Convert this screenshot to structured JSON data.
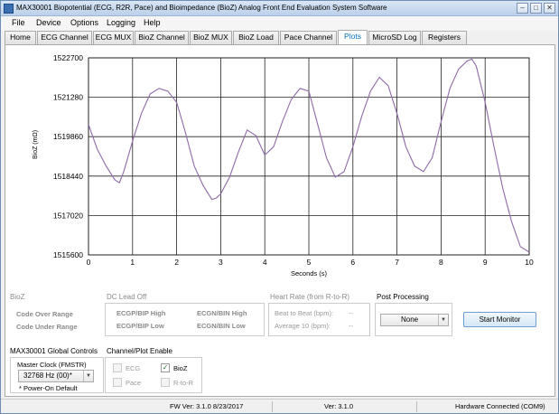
{
  "window": {
    "title": "MAX30001 Biopotential (ECG, R2R, Pace) and Bioimpedance (BioZ) Analog Front End Evaluation System Software",
    "controls": [
      "–",
      "□",
      "✕"
    ]
  },
  "menu": [
    "File",
    "Device",
    "Options",
    "Logging",
    "Help"
  ],
  "tabs": [
    "Home",
    "ECG Channel",
    "ECG MUX",
    "BioZ Channel",
    "BioZ MUX",
    "BioZ Load",
    "Pace Channel",
    "Plots",
    "MicroSD Log",
    "Registers"
  ],
  "active_tab": "Plots",
  "chart_data": {
    "type": "line",
    "title": "",
    "xlabel": "Seconds (s)",
    "ylabel": "BioZ (mΩ)",
    "xlim": [
      0,
      10
    ],
    "ylim": [
      1515600,
      1522700
    ],
    "x_ticks": [
      "0",
      "1",
      "2",
      "3",
      "4",
      "5",
      "6",
      "7",
      "8",
      "9",
      "10"
    ],
    "y_ticks": [
      "1522700",
      "1521280",
      "1519860",
      "1518440",
      "1517020",
      "1515600"
    ],
    "grid": true,
    "line_color": "#8e6aa8",
    "series": [
      {
        "x": [
          0,
          0.2,
          0.4,
          0.6,
          0.7,
          0.8,
          1.0,
          1.2,
          1.4,
          1.6,
          1.8,
          2.0,
          2.2,
          2.4,
          2.6,
          2.8,
          2.9,
          3.0,
          3.2,
          3.4,
          3.6,
          3.8,
          4.0,
          4.2,
          4.4,
          4.6,
          4.8,
          5.0,
          5.2,
          5.4,
          5.6,
          5.8,
          6.0,
          6.2,
          6.4,
          6.6,
          6.8,
          7.0,
          7.2,
          7.4,
          7.6,
          7.8,
          8.0,
          8.2,
          8.4,
          8.6,
          8.7,
          8.8,
          9.0,
          9.2,
          9.4,
          9.6,
          9.8,
          10.0
        ],
        "y": [
          1520300,
          1519400,
          1518800,
          1518300,
          1518200,
          1518600,
          1519700,
          1520700,
          1521400,
          1521600,
          1521500,
          1521100,
          1520000,
          1518800,
          1518100,
          1517600,
          1517650,
          1517800,
          1518400,
          1519300,
          1520100,
          1519900,
          1519200,
          1519500,
          1520400,
          1521200,
          1521600,
          1521500,
          1520300,
          1519100,
          1518400,
          1518600,
          1519500,
          1520600,
          1521500,
          1522000,
          1521700,
          1520700,
          1519500,
          1518800,
          1518600,
          1519100,
          1520400,
          1521600,
          1522300,
          1522600,
          1522650,
          1522400,
          1521100,
          1519500,
          1518000,
          1516800,
          1515900,
          1515700
        ]
      }
    ]
  },
  "bioz_group": {
    "title": "BioZ",
    "over": "Code Over Range",
    "under": "Code Under Range"
  },
  "dc_lead_off": {
    "title": "DC Lead Off",
    "ecgp_high": "ECGP/BIP High",
    "ecgn_high": "ECGN/BIN High",
    "ecgp_low": "ECGP/BIP Low",
    "ecgn_low": "ECGN/BIN Low"
  },
  "heart_rate": {
    "title": "Heart Rate (from R-to-R)",
    "b2b_label": "Beat to Beat (bpm):",
    "b2b_value": "--",
    "avg_label": "Average 10 (bpm):",
    "avg_value": "--"
  },
  "post_processing": {
    "title": "Post Processing",
    "selected": "None"
  },
  "start_monitor": "Start Monitor",
  "global_controls": {
    "title": "MAX30001 Global Controls",
    "master_clock_label": "Master Clock (FMSTR)",
    "master_clock_value": "32768 Hz (00)*",
    "note": "* Power-On Default"
  },
  "channel_enable": {
    "title": "Channel/Plot Enable",
    "ecg": "ECG",
    "bioz": "BioZ",
    "pace": "Pace",
    "r2r": "R-to-R",
    "ecg_checked": false,
    "bioz_checked": true
  },
  "status": {
    "fw": "FW Ver: 3.1.0 8/23/2017",
    "ver": "Ver: 3.1.0",
    "connection": "Hardware Connected (COM9)"
  }
}
